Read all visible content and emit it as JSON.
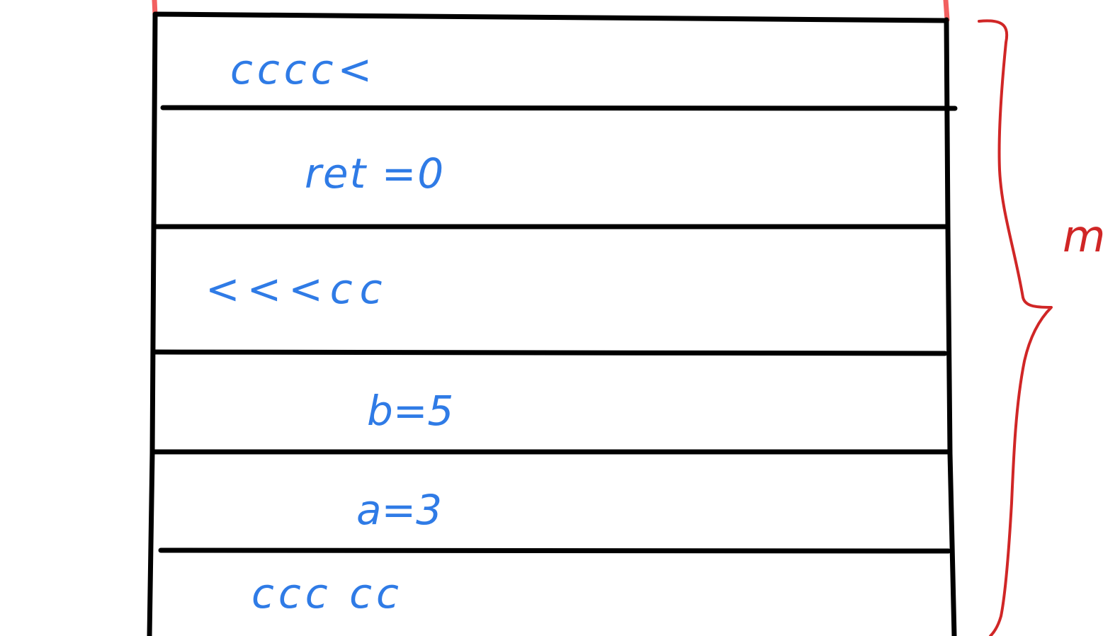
{
  "diagram": {
    "cells": [
      {
        "text": "cccc<"
      },
      {
        "text": "ret =0"
      },
      {
        "text": "<<<cc"
      },
      {
        "text": "b=5"
      },
      {
        "text": "a=3"
      },
      {
        "text": "ccc cc"
      }
    ],
    "bracket_label": "m",
    "colors": {
      "lines": "#000000",
      "cell_text": "#2f7be6",
      "annotation": "#d02626"
    }
  }
}
